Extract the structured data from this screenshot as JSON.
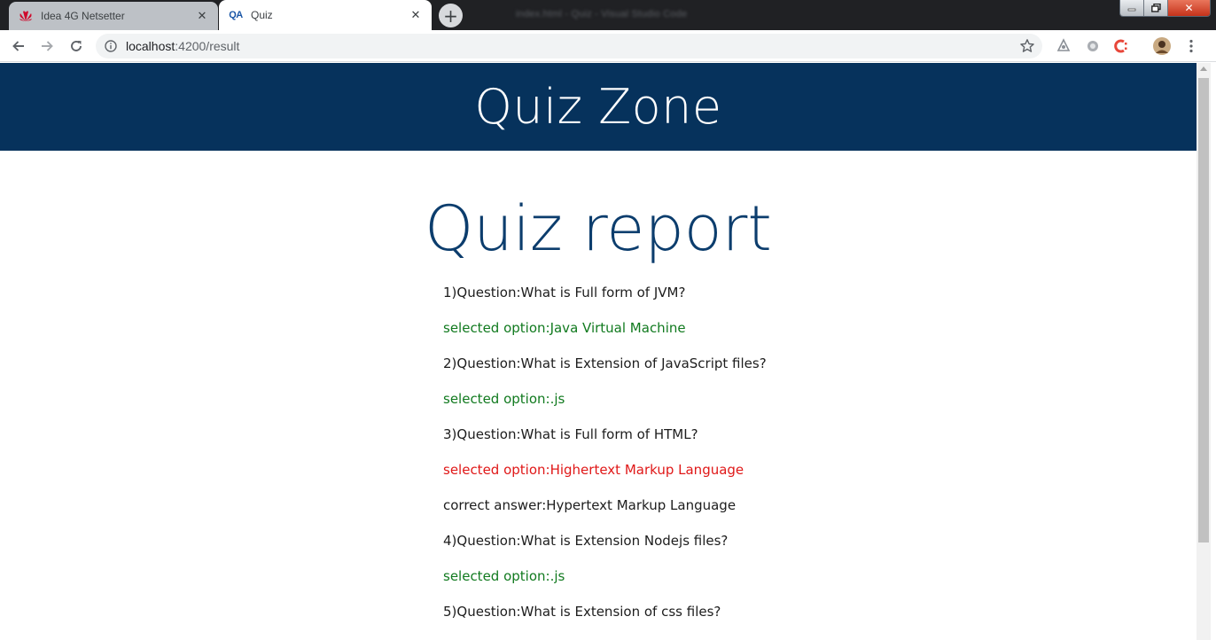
{
  "browser": {
    "window_title": "index.html - Quiz - Visual Studio Code",
    "tabs": [
      {
        "title": "Idea 4G Netsetter",
        "active": false,
        "favicon": "huawei-logo-icon"
      },
      {
        "title": "Quiz",
        "active": true,
        "favicon": "qa-logo-icon",
        "favicon_text": "QA"
      }
    ],
    "address": {
      "host": "localhost",
      "rest": ":4200/result"
    },
    "colors": {
      "frame": "#202124",
      "inactive_tab": "#bdc1c6",
      "active_tab": "#ffffff"
    }
  },
  "page": {
    "brand": "Quiz Zone",
    "title": "Quiz report",
    "colors": {
      "header_bg": "#06325c",
      "title": "#0c3d6d",
      "correct": "#117a1f",
      "wrong": "#e01818"
    },
    "lines": [
      {
        "text": "1)Question:What is Full form of JVM?",
        "kind": "question"
      },
      {
        "text": "selected option:Java Virtual Machine",
        "kind": "correct"
      },
      {
        "text": "2)Question:What is Extension of JavaScript files?",
        "kind": "question"
      },
      {
        "text": "selected option:.js",
        "kind": "correct"
      },
      {
        "text": "3)Question:What is Full form of HTML?",
        "kind": "question"
      },
      {
        "text": "selected option:Highertext Markup Language",
        "kind": "wrong"
      },
      {
        "text": "correct answer:Hypertext Markup Language",
        "kind": "answer"
      },
      {
        "text": "4)Question:What is Extension Nodejs files?",
        "kind": "question"
      },
      {
        "text": "selected option:.js",
        "kind": "correct"
      },
      {
        "text": "5)Question:What is Extension of css files?",
        "kind": "question"
      }
    ]
  }
}
